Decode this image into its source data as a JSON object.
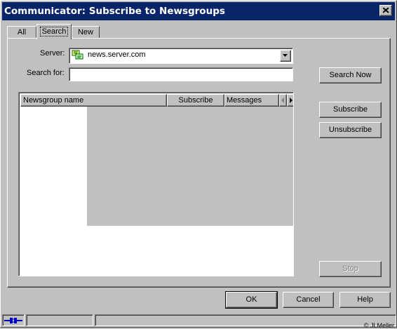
{
  "window": {
    "title": "Communicator: Subscribe to Newsgroups"
  },
  "tabs": [
    {
      "label": "All"
    },
    {
      "label": "Search"
    },
    {
      "label": "New"
    }
  ],
  "form": {
    "server_label": "Server:",
    "server_value": "news.server.com",
    "search_label": "Search for:",
    "search_value": ""
  },
  "buttons": {
    "search_now": "Search Now",
    "subscribe": "Subscribe",
    "unsubscribe": "Unsubscribe",
    "stop": "Stop",
    "ok": "OK",
    "cancel": "Cancel",
    "help": "Help"
  },
  "list": {
    "columns": [
      {
        "label": "Newsgroup name"
      },
      {
        "label": "Subscribe"
      },
      {
        "label": "Messages"
      }
    ],
    "rows": []
  },
  "footer": {
    "credit": "© JLMeller"
  },
  "icons": {
    "close": "close-icon",
    "server": "newsgroup-server-icon",
    "dropdown": "chevron-down-icon",
    "scroll_left": "arrow-left-icon",
    "scroll_right": "arrow-right-icon",
    "connection": "connection-status-icon"
  },
  "colors": {
    "titlebar": "#0a246a",
    "face": "#c0c0c0"
  }
}
